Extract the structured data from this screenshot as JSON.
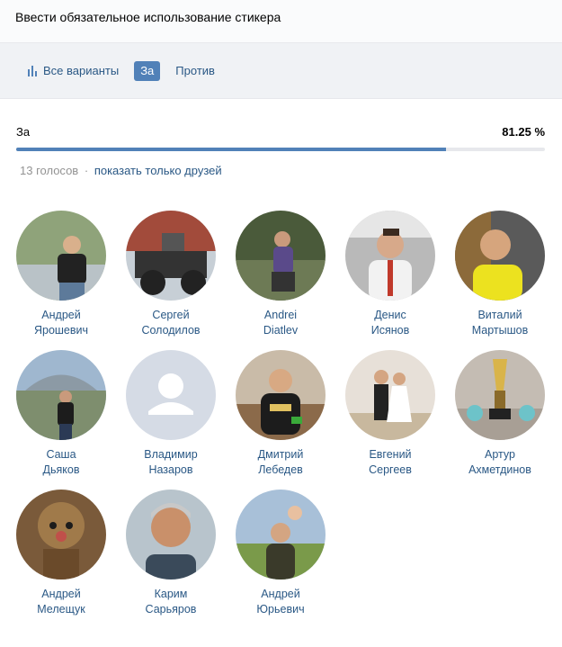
{
  "header": {
    "title": "Ввести обязательное использование стикера"
  },
  "tabs": [
    {
      "label": "Все варианты",
      "icon": "bar-chart-icon",
      "active": false
    },
    {
      "label": "За",
      "active": true
    },
    {
      "label": "Против",
      "active": false
    }
  ],
  "result": {
    "option": "За",
    "percent_label": "81.25 %",
    "fraction": 0.8125
  },
  "meta": {
    "votes": "13 голосов",
    "separator": "·",
    "friends_link": "показать только друзей"
  },
  "colors": {
    "accent": "#5181b8",
    "link": "#2a5885",
    "muted": "#939393"
  },
  "voters": [
    {
      "first": "Андрей",
      "last": "Ярошевич"
    },
    {
      "first": "Сергей",
      "last": "Солодилов"
    },
    {
      "first": "Andrei",
      "last": "Diatlev"
    },
    {
      "first": "Денис",
      "last": "Исянов"
    },
    {
      "first": "Виталий",
      "last": "Мартышов"
    },
    {
      "first": "Саша",
      "last": "Дьяков"
    },
    {
      "first": "Владимир",
      "last": "Назаров"
    },
    {
      "first": "Дмитрий",
      "last": "Лебедев"
    },
    {
      "first": "Евгений",
      "last": "Сергеев"
    },
    {
      "first": "Артур",
      "last": "Ахметдинов"
    },
    {
      "first": "Андрей",
      "last": "Мелещук"
    },
    {
      "first": "Карим",
      "last": "Сарьяров"
    },
    {
      "first": "Андрей",
      "last": "Юрьевич"
    }
  ]
}
